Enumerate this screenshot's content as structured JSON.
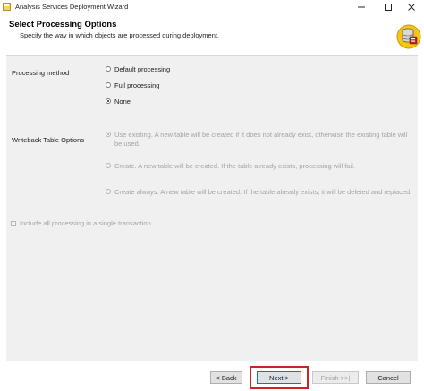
{
  "window": {
    "title": "Analysis Services Deployment Wizard"
  },
  "header": {
    "title": "Select Processing Options",
    "subtitle": "Specify the way in which objects are processed during deployment."
  },
  "processing": {
    "label": "Processing method",
    "options": [
      {
        "label": "Default processing",
        "selected": false
      },
      {
        "label": "Full processing",
        "selected": false
      },
      {
        "label": "None",
        "selected": true
      }
    ]
  },
  "writeback": {
    "label": "Writeback Table Options",
    "options": [
      {
        "label": "Use existing. A new table will be created if it does not already exist, otherwise the existing table will be used.",
        "selected": true,
        "enabled": false
      },
      {
        "label": "Create. A new table will be created. If the table already exists, processing will fail.",
        "selected": false,
        "enabled": false
      },
      {
        "label": "Create always. A new table will be created. If the table already exists, it will be deleted and replaced.",
        "selected": false,
        "enabled": false
      }
    ]
  },
  "transaction": {
    "label": "Include all processing in a single transaction",
    "checked": false,
    "enabled": false
  },
  "buttons": {
    "back": "< Back",
    "next": "Next >",
    "finish": "Finish >>|",
    "cancel": "Cancel"
  },
  "colors": {
    "highlight": "#d0202a",
    "panel": "#f0f0f0",
    "default_button_border": "#0078d7"
  }
}
